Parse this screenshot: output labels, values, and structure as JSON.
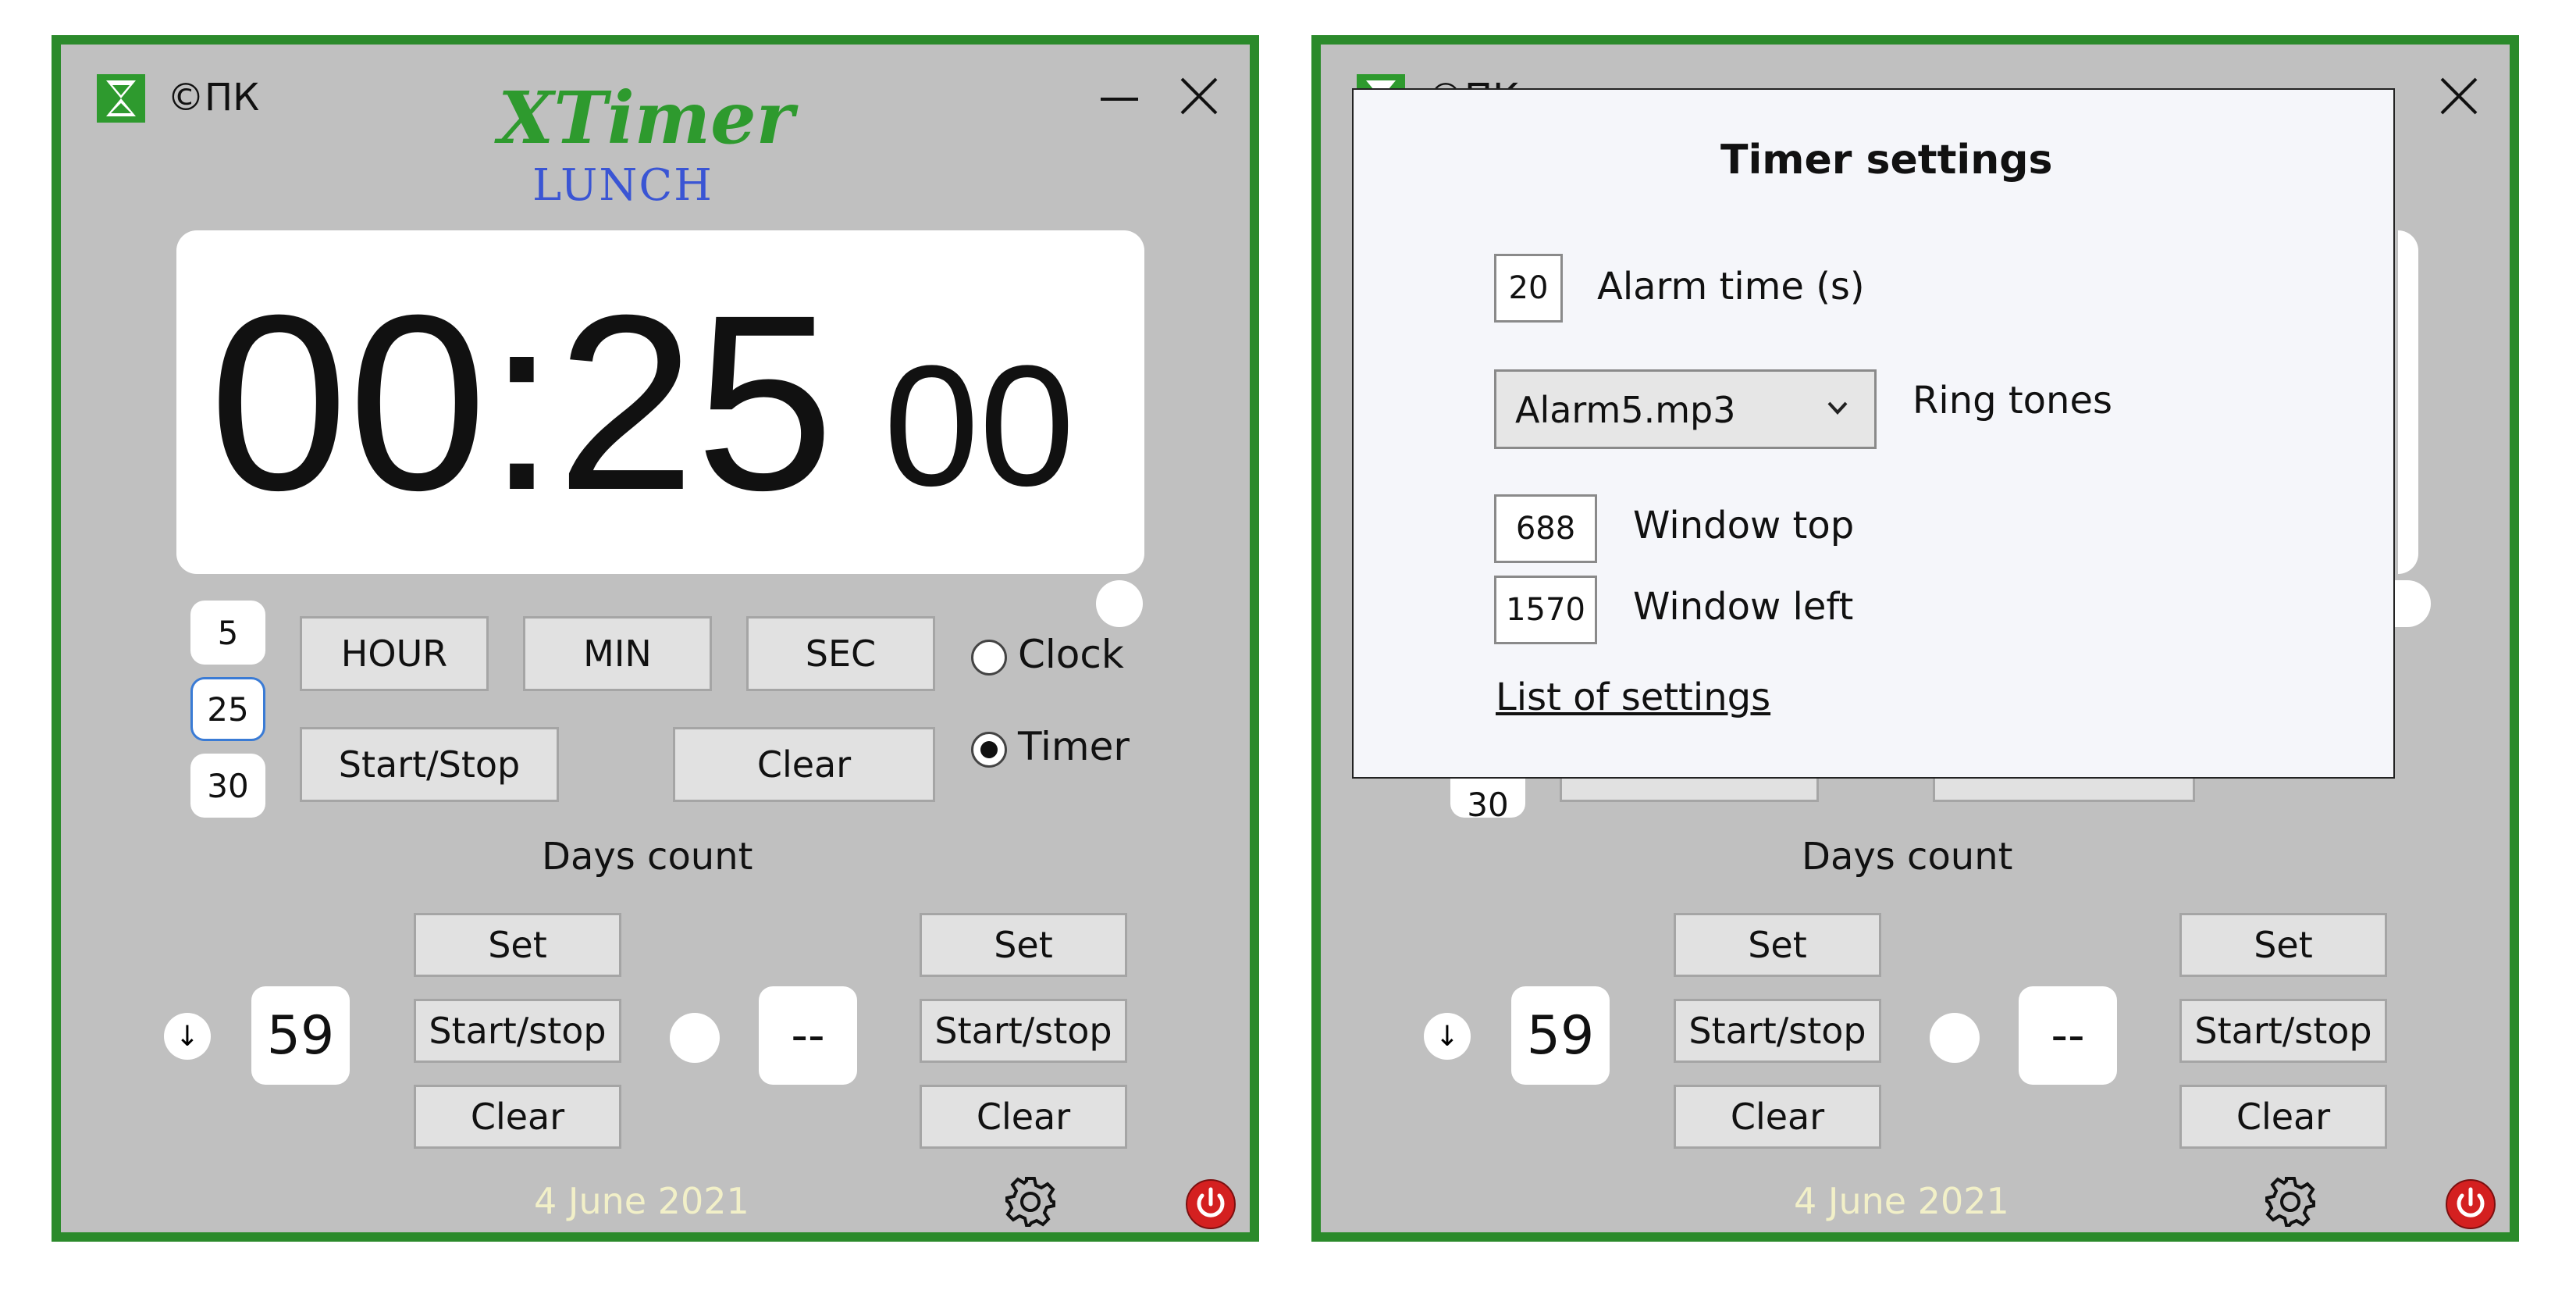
{
  "window1": {
    "copyright": "©ПК",
    "app_title": "XTimer",
    "subtitle": "LUNCH",
    "display": {
      "main": "00:25",
      "seconds": "00"
    },
    "presets": [
      "5",
      "25",
      "30"
    ],
    "buttons": {
      "hour": "HOUR",
      "min": "MIN",
      "sec": "SEC",
      "start_stop": "Start/Stop",
      "clear": "Clear"
    },
    "modes": {
      "clock": "Clock",
      "timer": "Timer"
    },
    "days": {
      "label": "Days count",
      "arrow": "↓",
      "left_value": "59",
      "right_value": "--",
      "set": "Set",
      "start_stop": "Start/stop",
      "clear": "Clear"
    },
    "date": "4 June 2021"
  },
  "window2": {
    "copyright": "©ПК",
    "settings": {
      "title": "Timer settings",
      "alarm_value": "20",
      "alarm_label": "Alarm time (s)",
      "ringtone_value": "Alarm5.mp3",
      "ringtone_label": "Ring tones",
      "top_value": "688",
      "top_label": "Window top",
      "left_value": "1570",
      "left_label": "Window left",
      "list_link": "List of settings"
    },
    "preset_partial": "30",
    "days": {
      "label": "Days count",
      "arrow": "↓",
      "left_value": "59",
      "right_value": "--",
      "set": "Set",
      "start_stop": "Start/stop",
      "clear": "Clear"
    },
    "date": "4 June 2021"
  },
  "colors": {
    "frame": "#2b8a2b",
    "title_green": "#2e9a2e",
    "subtitle_blue": "#3a55d4",
    "date_text": "#f2f0c8",
    "power_red": "#d42020"
  },
  "icons": [
    "hourglass-icon",
    "minimize-icon",
    "close-icon",
    "gear-icon",
    "power-icon",
    "chevron-down-icon"
  ]
}
